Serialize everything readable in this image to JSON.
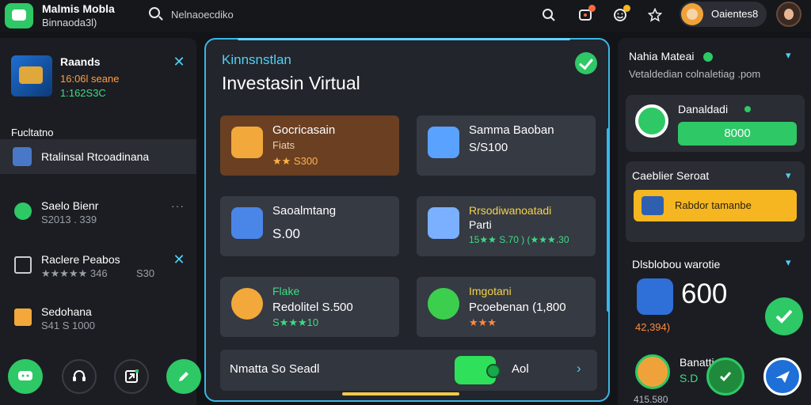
{
  "app": {
    "title": "Malmis Mobla",
    "subtitle": "Binnaoda3l)"
  },
  "search": {
    "placeholder": "Nelnaoecdiko"
  },
  "profile": {
    "name": "Oaientes8"
  },
  "sidebar": {
    "promo": {
      "title": "Raands",
      "line1": "16:06l seane",
      "line2": "1:162S3C"
    },
    "section_label": "Fucltatno",
    "active_item": {
      "label": "Rtalinsal Rtcoadinana"
    },
    "items": [
      {
        "title": "Saelo Bienr",
        "sub": "S2013 . 339",
        "extra": "",
        "icon_color": "#2ec866"
      },
      {
        "title": "Raclere Peabos",
        "sub": "★★★★★ 346",
        "extra": "S30",
        "icon_color": "#c9ccd2"
      },
      {
        "title": "Sedohana",
        "sub": "S41 S 1000",
        "extra": "",
        "icon_color": "#f2a83a"
      }
    ],
    "dock": [
      "chat-icon",
      "support-icon",
      "exit-icon",
      "edit-icon"
    ]
  },
  "main": {
    "kicker": "Kinnsnstlan",
    "title": "Investasin Virtual",
    "cards": [
      {
        "title": "Gocricasain",
        "line2": "Fiats",
        "line3": "★★ S300",
        "line3_color": "#ffb347",
        "bg": "#6a3f22",
        "icon_color": "#f2a83a"
      },
      {
        "title": "Samma Baoban",
        "line2": "S/S100",
        "line3": "",
        "line3_color": "#ffffff",
        "bg": "#363a43",
        "icon_color": "#5aa2ff"
      },
      {
        "title": "Saoalmtang",
        "line2": "S.00",
        "line3": "",
        "line3_color": "#ffffff",
        "bg": "#363a43",
        "icon_color": "#4a86e8"
      },
      {
        "title": "Rrsodiwanoatadi",
        "line2": "Parti",
        "line3": "15★★ S.70 ) (★★★.30",
        "line3_color": "#3ddc84",
        "bg": "#363a43",
        "icon_color": "#7ab0ff"
      },
      {
        "title": "Flake",
        "line2": "Redolitel  S.500",
        "line3": "S★★★10",
        "line3_color": "#3ddc84",
        "bg": "#363a43",
        "icon_color": "#f2a83a"
      },
      {
        "title": "Imgotani",
        "line2": "Pcoebenan  (1,800",
        "line3": "★★★",
        "line3_color": "#ff8a3d",
        "bg": "#363a43",
        "icon_color": "#3ccf4e"
      }
    ],
    "footer": {
      "label": "Nmatta So Seadl",
      "action": "Aol"
    }
  },
  "right": {
    "header": {
      "title": "Nahia Mateai",
      "desc": "Vetaldedian colnaletiag .pom"
    },
    "card1": {
      "title": "Danaldadi",
      "button": "8000"
    },
    "card2": {
      "title": "Caeblier Seroat",
      "button": "Rabdor tamanbe"
    },
    "card3": {
      "title": "Dlsblobou warotie",
      "number": "600",
      "sub": "42,394)"
    },
    "bottom": {
      "title": "Banatti",
      "sub": "S.D",
      "small": "415.580"
    }
  },
  "colors": {
    "accent_blue": "#39b6e8",
    "accent_green": "#2ec866",
    "accent_yellow": "#f5b621"
  }
}
